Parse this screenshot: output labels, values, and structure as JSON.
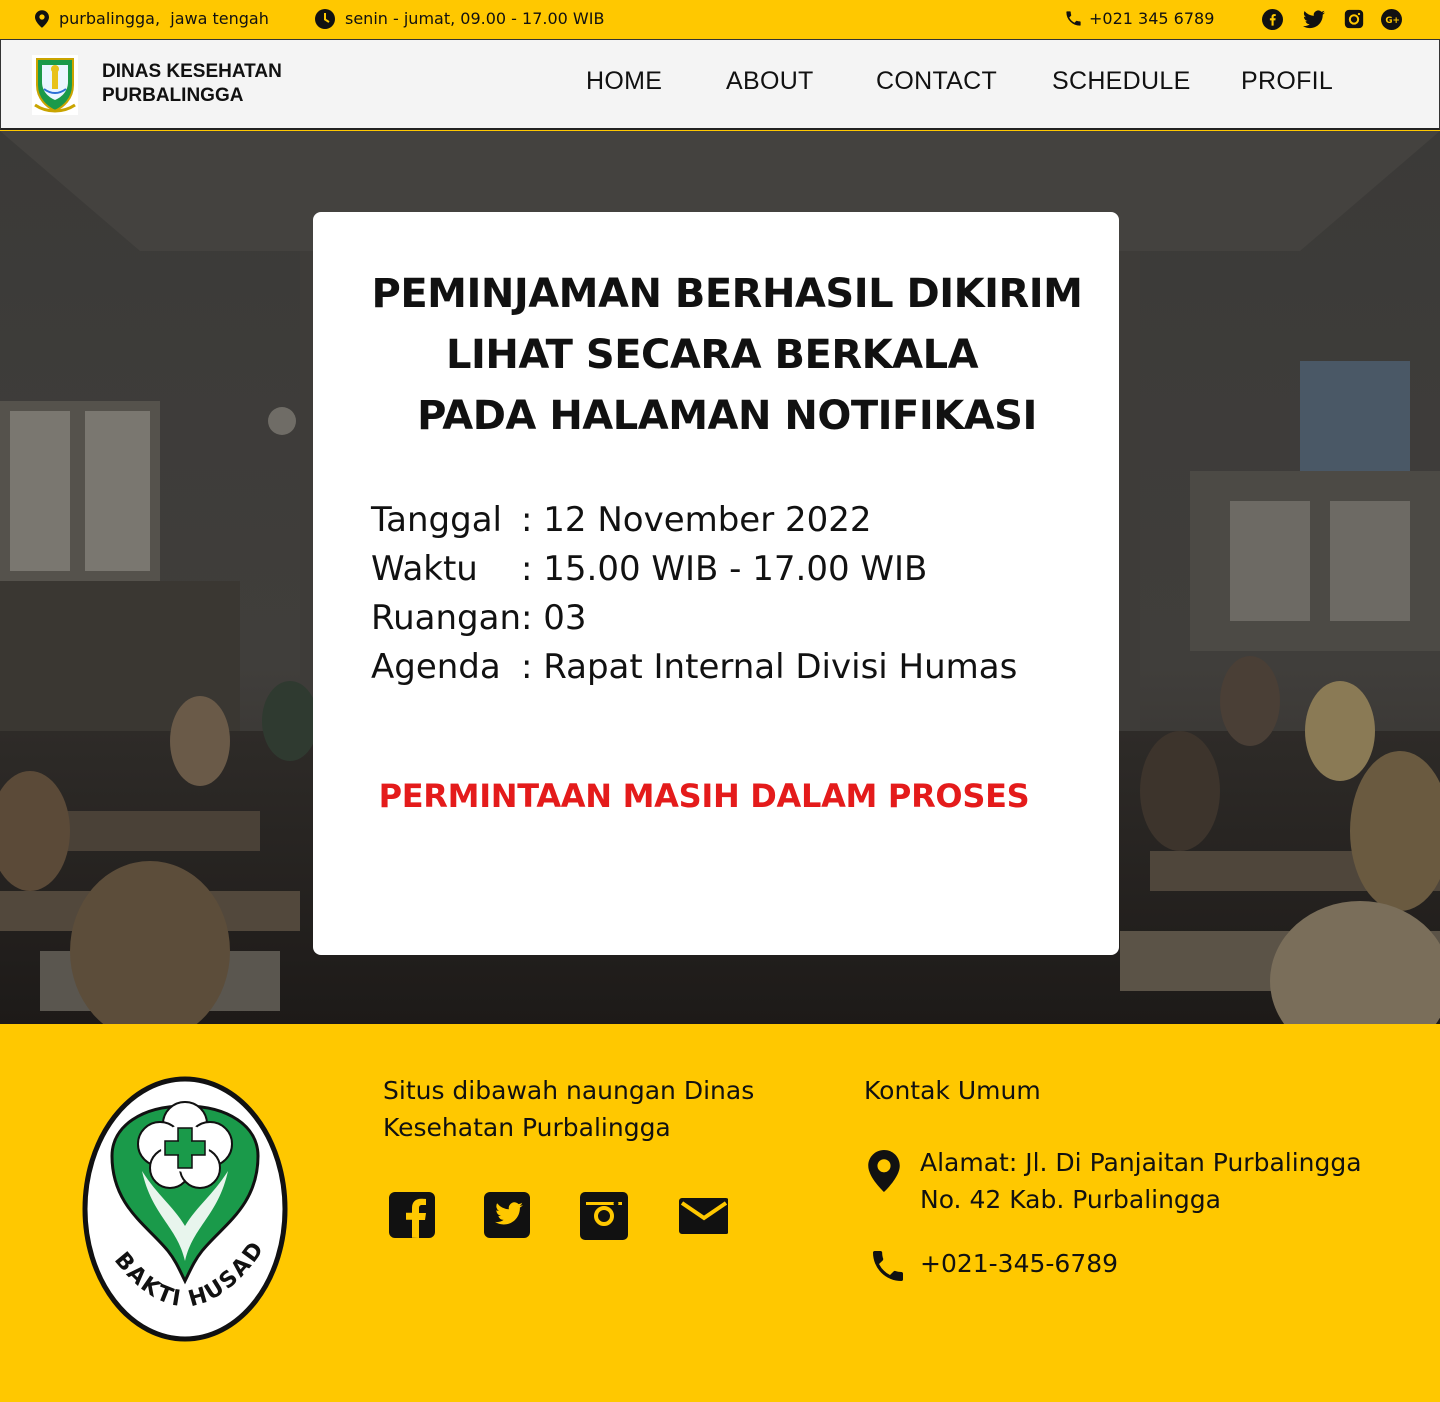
{
  "topbar": {
    "location": "purbalingga,  jawa tengah",
    "hours": "senin - jumat, 09.00 - 17.00 WIB",
    "phone": "+021 345 6789",
    "social_icons": [
      "facebook-icon",
      "twitter-icon",
      "instagram-icon",
      "google-plus-icon"
    ]
  },
  "header": {
    "brand_line1": "DINAS KESEHATAN",
    "brand_line2": "PURBALINGGA",
    "nav": [
      "HOME",
      "ABOUT",
      "CONTACT",
      "SCHEDULE",
      "PROFIL"
    ]
  },
  "card": {
    "title_lines": [
      "PEMINJAMAN BERHASIL DIKIRIM",
      "LIHAT SECARA BERKALA",
      "PADA HALAMAN NOTIFIKASI"
    ],
    "details": [
      {
        "label": "Tanggal",
        "value": ": 12 November 2022"
      },
      {
        "label": "Waktu",
        "value": ": 15.00 WIB - 17.00 WIB"
      },
      {
        "label": "Ruangan",
        "value": ": 03"
      },
      {
        "label": "Agenda",
        "value": ": Rapat Internal Divisi Humas"
      }
    ],
    "status": "PERMINTAAN MASIH DALAM PROSES",
    "status_color": "#e41b1b"
  },
  "footer": {
    "logo_text": "BAKTI HUSADA",
    "about_line1": "Situs dibawah naungan Dinas",
    "about_line2": "Kesehatan Purbalingga",
    "contact_title": "Kontak Umum",
    "address_line1": "Alamat: Jl. Di Panjaitan Purbalingga",
    "address_line2": "No. 42 Kab. Purbalingga",
    "phone": "+021-345-6789",
    "social_icons": [
      "facebook-icon",
      "twitter-icon",
      "instagram-icon",
      "mail-icon"
    ]
  },
  "colors": {
    "brand_yellow": "#ffc800",
    "logo_green": "#1a9a4a"
  }
}
